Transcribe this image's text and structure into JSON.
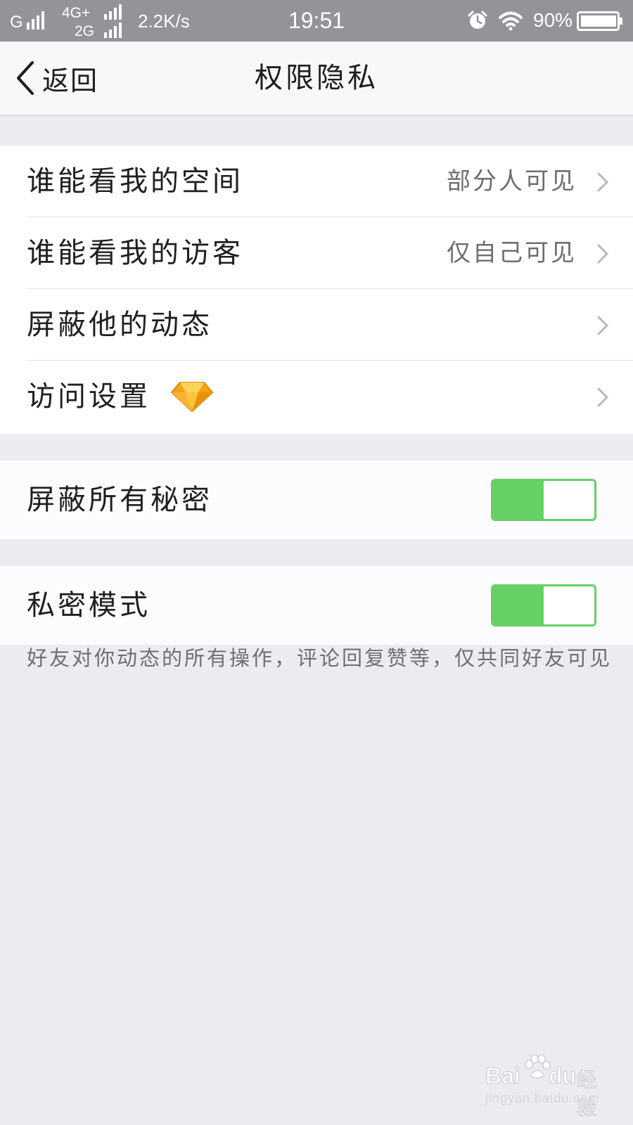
{
  "status_bar": {
    "carrier1": "G",
    "carrier2_top": "4G+",
    "carrier2_bottom": "2G",
    "speed": "2.2K/s",
    "time": "19:51",
    "battery": "90%",
    "icons": [
      "signal-icon",
      "alarm-icon",
      "wifi-icon",
      "battery-icon"
    ]
  },
  "nav": {
    "back_label": "返回",
    "title": "权限隐私"
  },
  "settings": [
    {
      "label": "谁能看我的空间",
      "value": "部分人可见"
    },
    {
      "label": "谁能看我的访客",
      "value": "仅自己可见"
    },
    {
      "label": "屏蔽他的动态",
      "value": ""
    },
    {
      "label": "访问设置",
      "value": "",
      "badge_icon": "diamond-icon"
    }
  ],
  "toggles": [
    {
      "label": "屏蔽所有秘密",
      "on": true
    },
    {
      "label": "私密模式",
      "on": true
    }
  ],
  "footnote": "好友对你动态的所有操作，评论回复赞等，仅共同好友可见",
  "watermark": {
    "brand": "Bai",
    "brand2": "du",
    "suffix": "经验",
    "url": "jingyan.baidu.com"
  },
  "colors": {
    "toggle_on": "#66d064",
    "statusbar": "#949398",
    "background": "#ecebef"
  }
}
